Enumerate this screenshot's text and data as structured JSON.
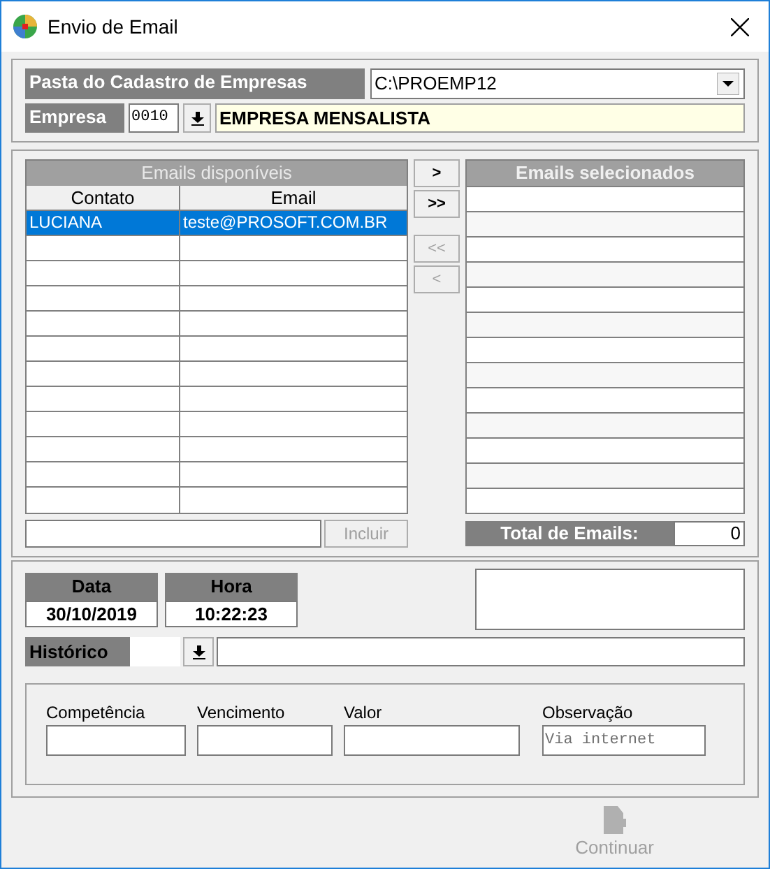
{
  "window": {
    "title": "Envio de Email"
  },
  "pasta": {
    "label": "Pasta do Cadastro de Empresas",
    "value": "C:\\PROEMP12"
  },
  "empresa": {
    "label": "Empresa",
    "code": "0010",
    "name": "EMPRESA MENSALISTA"
  },
  "available": {
    "title": "Emails disponíveis",
    "columns": [
      "Contato",
      "Email"
    ],
    "rows": [
      {
        "contato": "LUCIANA",
        "email": "teste@PROSOFT.COM.BR",
        "selected": true
      }
    ]
  },
  "include_button": {
    "label": "Incluir",
    "disabled": true
  },
  "move_buttons": [
    {
      "label": ">",
      "disabled": false
    },
    {
      "label": ">>",
      "disabled": false
    },
    {
      "label": "<<",
      "disabled": true
    },
    {
      "label": "<",
      "disabled": true
    }
  ],
  "selected_list": {
    "title": "Emails selecionados"
  },
  "total": {
    "label": "Total de Emails:",
    "value": "0"
  },
  "data": {
    "label": "Data",
    "value": "30/10/2019"
  },
  "hora": {
    "label": "Hora",
    "value": "10:22:23"
  },
  "historico": {
    "label": "Histórico"
  },
  "fields": [
    {
      "label": "Competência"
    },
    {
      "label": "Vencimento"
    },
    {
      "label": "Valor"
    },
    {
      "label": "Observação",
      "placeholder": "Via internet"
    }
  ],
  "continue_button": {
    "label": "Continuar",
    "disabled": true
  }
}
